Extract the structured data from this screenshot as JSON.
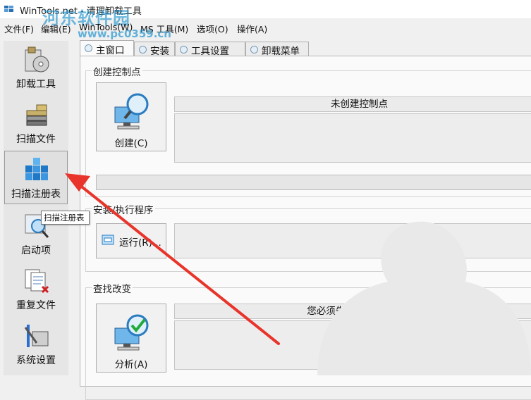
{
  "title_bar": {
    "title": "WinTools.net - 清理卸载工具",
    "watermark_site": "河东软件园",
    "watermark_url": "www.pc0359.cn"
  },
  "menu": {
    "items": [
      "文件(F)",
      "编辑(E)",
      "WinTools(W)",
      "MS 工具(M)",
      "选项(O)",
      "操作(A)"
    ]
  },
  "sidebar": {
    "items": [
      {
        "label": "卸载工具",
        "icon": "uninstall-tools-icon"
      },
      {
        "label": "扫描文件",
        "icon": "scan-files-icon"
      },
      {
        "label": "扫描注册表",
        "icon": "scan-registry-icon",
        "active": true
      },
      {
        "label": "启动项",
        "icon": "startup-items-icon"
      },
      {
        "label": "重复文件",
        "icon": "duplicate-files-icon"
      },
      {
        "label": "系统设置",
        "icon": "system-settings-icon"
      }
    ],
    "tooltip": "扫描注册表"
  },
  "tabs": [
    "主窗口",
    "安装",
    "工具设置",
    "卸载菜单"
  ],
  "create_checkpoint": {
    "title": "创建控制点",
    "button_label": "创建(C)",
    "status": "未创建控制点"
  },
  "install_program": {
    "title": "安装/执行程序",
    "button_label": "运行(R)..."
  },
  "find_changes": {
    "title": "查找改变",
    "button_label": "分析(A)",
    "status": "您必须先创建一个控制点"
  },
  "colors": {
    "annotation_arrow": "#e8342a",
    "watermark": "#2494cd"
  }
}
